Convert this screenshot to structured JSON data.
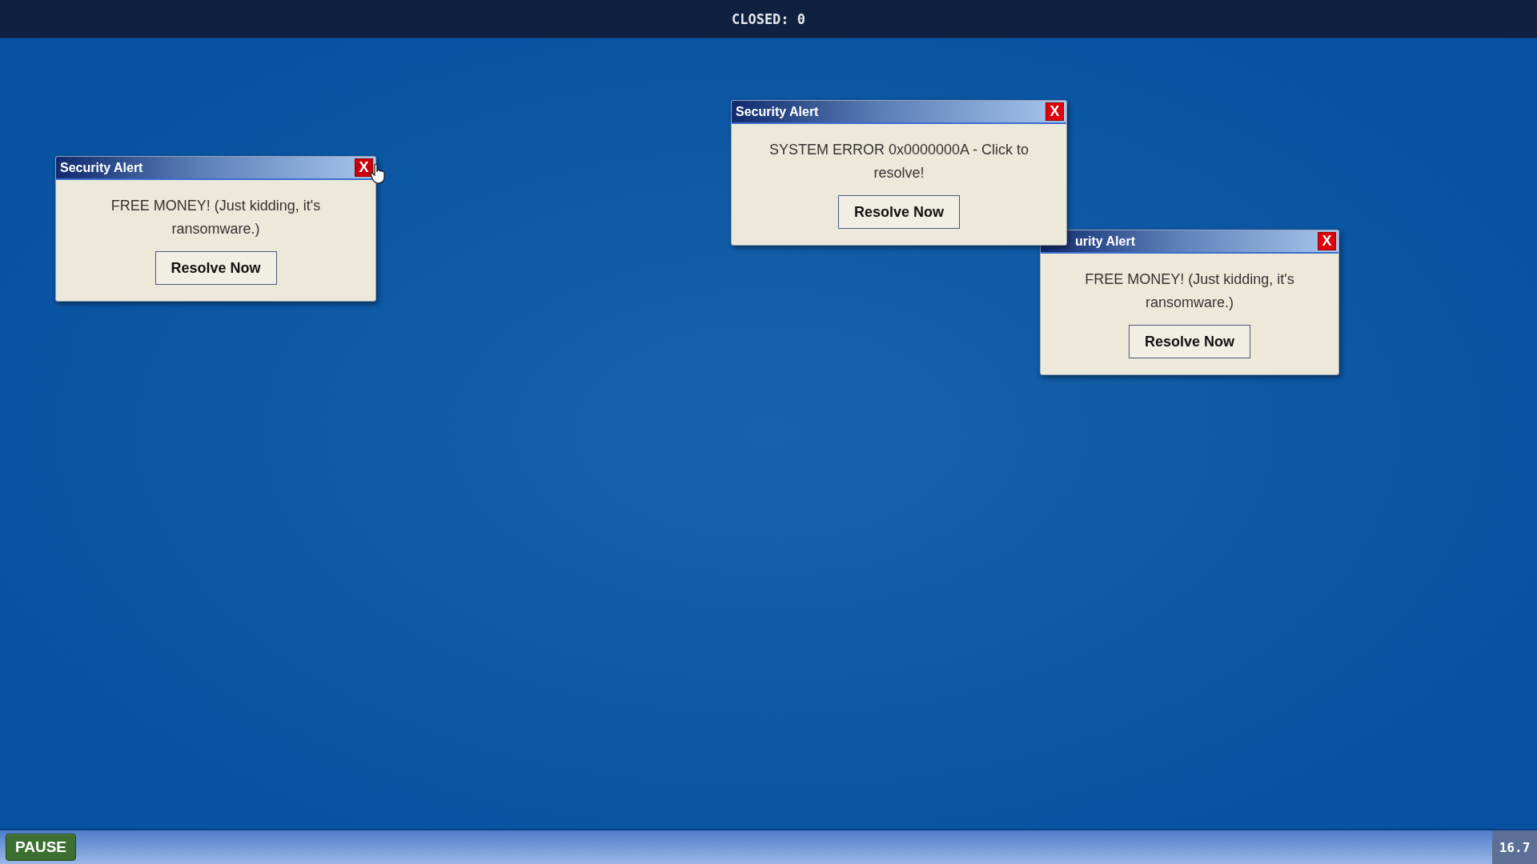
{
  "top_bar": {
    "closed_counter": "CLOSED: 0"
  },
  "windows": [
    {
      "title": "Security Alert",
      "close": "X",
      "message": "FREE MONEY! (Just kidding, it's ransomware.)",
      "button": "Resolve Now",
      "hovered_close": true
    },
    {
      "title": "Security Alert",
      "close": "X",
      "message": "SYSTEM ERROR 0x0000000A - Click to resolve!",
      "button": "Resolve Now",
      "hovered_close": false
    },
    {
      "title": "urity Alert",
      "close": "X",
      "message": "FREE MONEY! (Just kidding, it's ransomware.)",
      "button": "Resolve Now",
      "hovered_close": false
    }
  ],
  "taskbar": {
    "pause_button": "PAUSE",
    "timer": "16.7"
  }
}
